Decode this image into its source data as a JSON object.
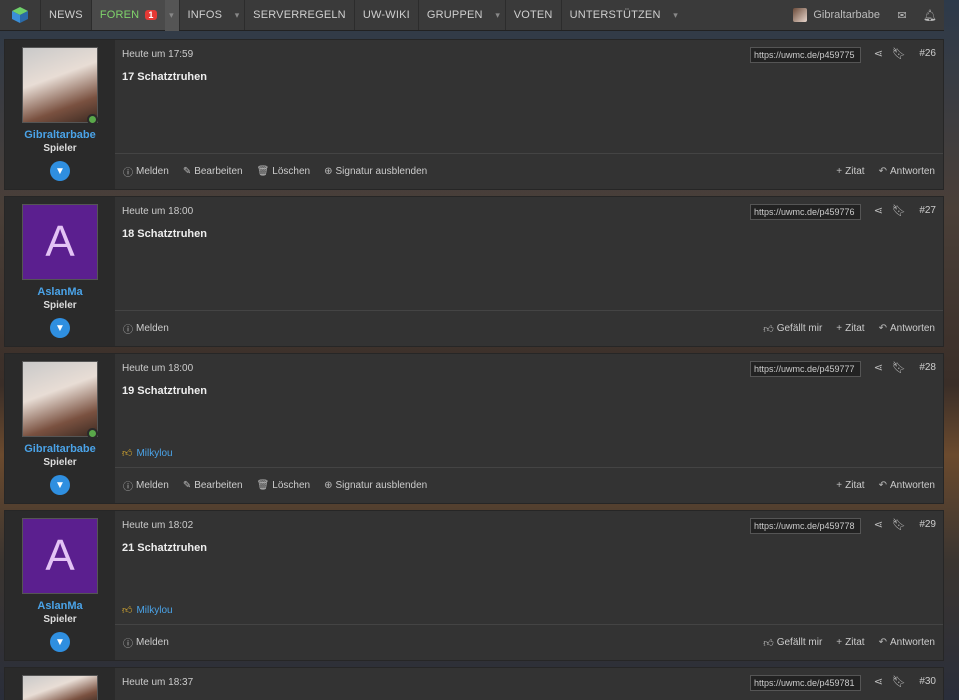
{
  "nav": {
    "items": [
      {
        "label": "NEWS",
        "dropdown": false
      },
      {
        "label": "FOREN",
        "badge": "1",
        "active": true,
        "dropdown": true
      },
      {
        "label": "INFOS",
        "dropdown": true
      },
      {
        "label": "SERVERREGELN",
        "dropdown": false
      },
      {
        "label": "UW-WIKI",
        "dropdown": false
      },
      {
        "label": "GRUPPEN",
        "dropdown": true
      },
      {
        "label": "VOTEN",
        "dropdown": false
      },
      {
        "label": "UNTERSTÜTZEN",
        "dropdown": true
      }
    ],
    "user": "Gibraltarbabe"
  },
  "posts": [
    {
      "time": "Heute um 17:59",
      "text": "17 Schatztruhen",
      "link": "https://uwmc.de/p459775",
      "num": "#26",
      "user": "Gibraltarbabe",
      "title": "Spieler",
      "avatar": "image",
      "own": true
    },
    {
      "time": "Heute um 18:00",
      "text": "18 Schatztruhen",
      "link": "https://uwmc.de/p459776",
      "num": "#27",
      "user": "AslanMa",
      "title": "Spieler",
      "avatar": "A",
      "own": false
    },
    {
      "time": "Heute um 18:00",
      "text": "19 Schatztruhen",
      "link": "https://uwmc.de/p459777",
      "num": "#28",
      "user": "Gibraltarbabe",
      "title": "Spieler",
      "avatar": "image",
      "own": true,
      "like": "Milkylou"
    },
    {
      "time": "Heute um 18:02",
      "text": "21 Schatztruhen",
      "link": "https://uwmc.de/p459778",
      "num": "#29",
      "user": "AslanMa",
      "title": "Spieler",
      "avatar": "A",
      "own": false,
      "like": "Milkylou"
    },
    {
      "time": "Heute um 18:37",
      "text": "",
      "link": "https://uwmc.de/p459781",
      "num": "#30",
      "user": "",
      "title": "",
      "avatar": "image2",
      "own": false
    }
  ],
  "actions": {
    "report": "Melden",
    "edit": "Bearbeiten",
    "delete": "Löschen",
    "signature": "Signatur ausblenden",
    "like": "Gefällt mir",
    "quote": "Zitat",
    "reply": "Antworten"
  }
}
